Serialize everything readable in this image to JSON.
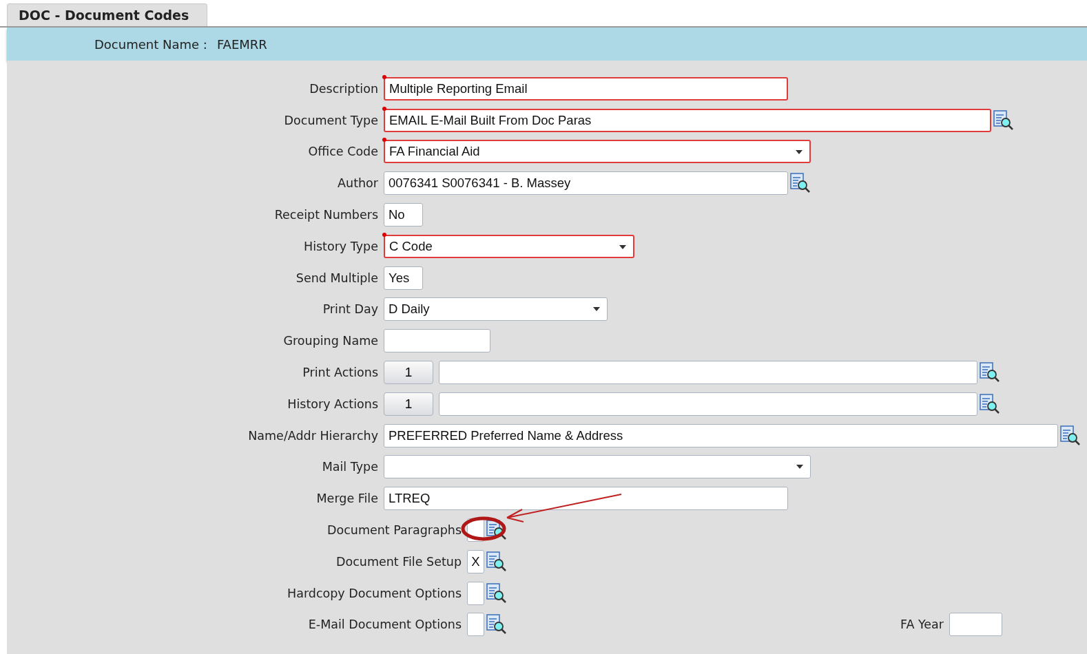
{
  "tab": {
    "label": "DOC - Document Codes",
    "selected": true
  },
  "header": {
    "label": "Document Name :",
    "value": "FAEMRR"
  },
  "rows": [
    {
      "kind": "text",
      "label": "Description",
      "value": "Multiple Reporting Email",
      "required": true
    },
    {
      "kind": "lookup",
      "label": "Document Type",
      "value": "EMAIL E-Mail Built From Doc Paras",
      "required": true
    },
    {
      "kind": "dropdown",
      "label": "Office Code",
      "value": "FA Financial Aid",
      "required": true
    },
    {
      "kind": "lookup",
      "label": "Author",
      "value": "0076341 S0076341 - B. Massey",
      "required": false
    },
    {
      "kind": "text",
      "label": "Receipt Numbers",
      "value": "No",
      "required": false
    },
    {
      "kind": "dropdown",
      "label": "History Type",
      "value": "C Code",
      "required": true
    },
    {
      "kind": "text",
      "label": "Send Multiple",
      "value": "Yes",
      "required": false
    },
    {
      "kind": "dropdown",
      "label": "Print Day",
      "value": "D Daily",
      "required": false
    },
    {
      "kind": "text",
      "label": "Grouping Name",
      "required": false
    },
    {
      "kind": "actions",
      "label": "Print Actions",
      "count": "1",
      "required": false
    },
    {
      "kind": "actions",
      "label": "History Actions",
      "count": "1",
      "required": false
    },
    {
      "kind": "lookup",
      "label": "Name/Addr Hierarchy",
      "value": "PREFERRED Preferred Name & Address",
      "required": false
    },
    {
      "kind": "dropdown",
      "label": "Mail Type",
      "required": false
    },
    {
      "kind": "text",
      "label": "Merge File",
      "value": "LTREQ",
      "required": false
    },
    {
      "kind": "check",
      "label": "Document Paragraphs",
      "required": false
    },
    {
      "kind": "check",
      "label": "Document File Setup",
      "value": "X",
      "required": false
    },
    {
      "kind": "check",
      "label": "Hardcopy Document Options",
      "required": false
    },
    {
      "kind": "check",
      "label": "E-Mail Document Options",
      "required": false,
      "side_field": {
        "label": "FA Year"
      }
    }
  ]
}
